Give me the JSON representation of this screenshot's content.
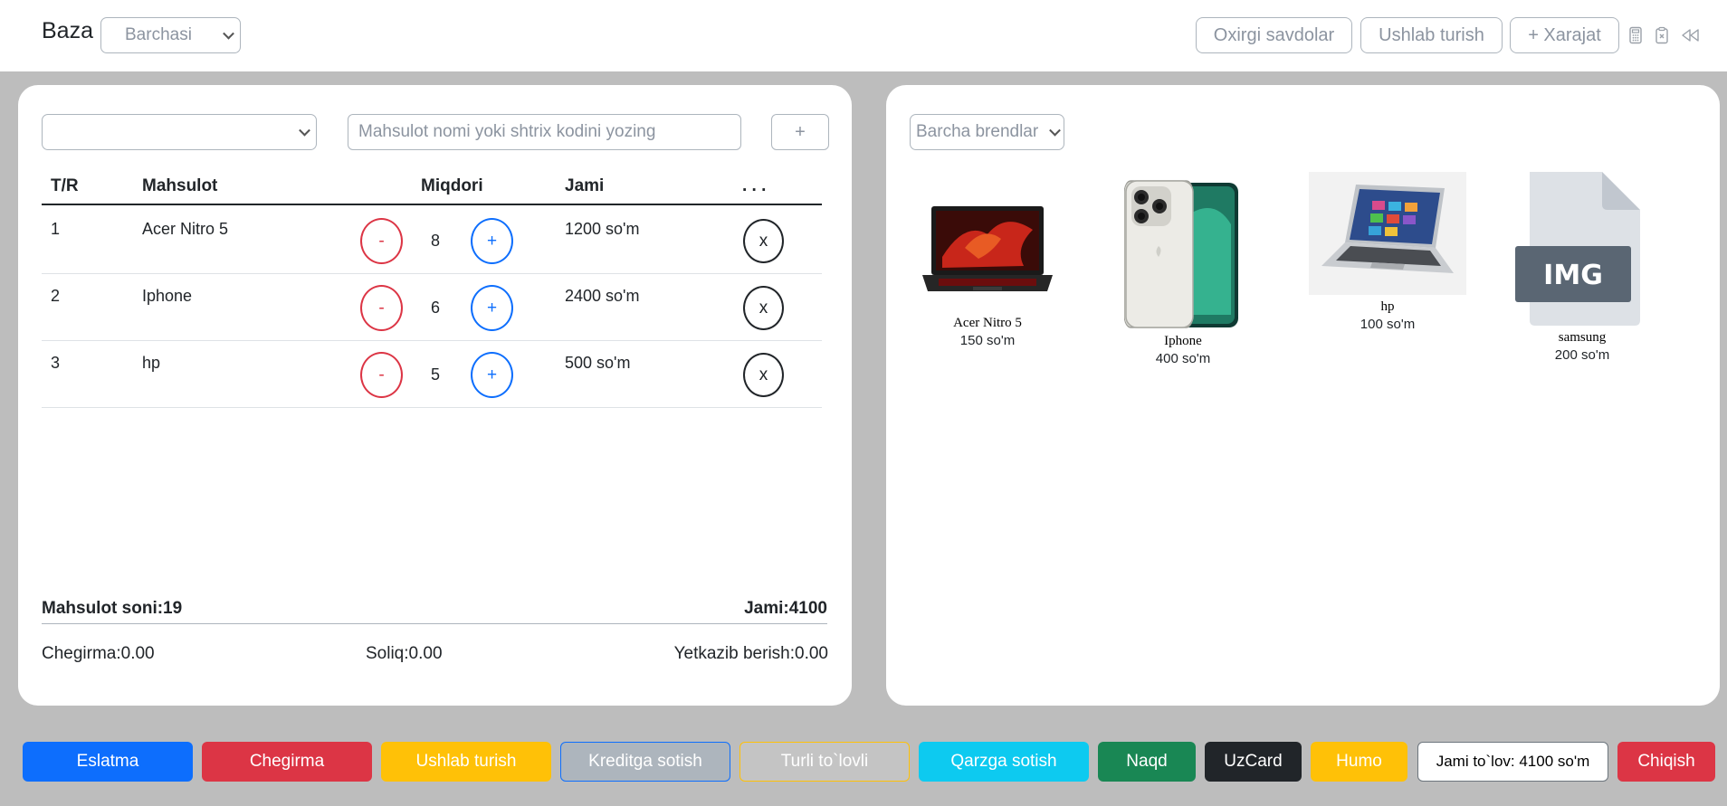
{
  "header": {
    "brand": "Baza",
    "filter_select": "Barchasi",
    "buttons": [
      "Oxirgi savdolar",
      "Ushlab turish",
      "+ Xarajat"
    ],
    "icons": [
      "calculator-icon",
      "clipboard-x-icon",
      "rewind-icon"
    ]
  },
  "cart": {
    "category_select": "",
    "search_placeholder": "Mahsulot nomi yoki shtrix kodini yozing",
    "add_label": "+",
    "columns": [
      "T/R",
      "Mahsulot",
      "Miqdori",
      "Jami",
      ". . ."
    ],
    "rows": [
      {
        "index": "1",
        "name": "Acer Nitro 5",
        "minus": "-",
        "qty": "8",
        "plus": "+",
        "total": "1200 so'm",
        "remove": "x"
      },
      {
        "index": "2",
        "name": "Iphone",
        "minus": "-",
        "qty": "6",
        "plus": "+",
        "total": "2400 so'm",
        "remove": "x"
      },
      {
        "index": "3",
        "name": "hp",
        "minus": "-",
        "qty": "5",
        "plus": "+",
        "total": "500 so'm",
        "remove": "x"
      }
    ],
    "summary": {
      "count": "Mahsulot soni:19",
      "total": "Jami:4100",
      "discount": "Chegirma:0.00",
      "tax": "Soliq:0.00",
      "delivery": "Yetkazib berish:0.00"
    }
  },
  "catalog": {
    "brand_select": "Barcha brendlar",
    "products": [
      {
        "name": "Acer Nitro 5",
        "price": "150 so'm"
      },
      {
        "name": "Iphone",
        "price": "400 so'm"
      },
      {
        "name": "hp",
        "price": "100 so'm"
      },
      {
        "name": "samsung",
        "price": "200 so'm",
        "placeholder_text": "IMG"
      }
    ]
  },
  "footer": {
    "buttons": [
      {
        "label": "Eslatma",
        "color": "#0d6efd"
      },
      {
        "label": "Chegirma",
        "color": "#dc3545"
      },
      {
        "label": "Ushlab turish",
        "color": "#ffc107"
      },
      {
        "label": "Kreditga sotish",
        "color": "#adb5bd"
      },
      {
        "label": "Turli to`lovli",
        "color": "#ffc107"
      },
      {
        "label": "Qarzga sotish",
        "color": "#0dcaf0"
      },
      {
        "label": "Naqd",
        "color": "#198754"
      },
      {
        "label": "UzCard",
        "color": "#212529"
      },
      {
        "label": "Humo",
        "color": "#ffc107"
      },
      {
        "label": "Jami to`lov: 4100 so'm",
        "color": "#ffffff"
      },
      {
        "label": "Chiqish",
        "color": "#dc3545"
      }
    ]
  }
}
